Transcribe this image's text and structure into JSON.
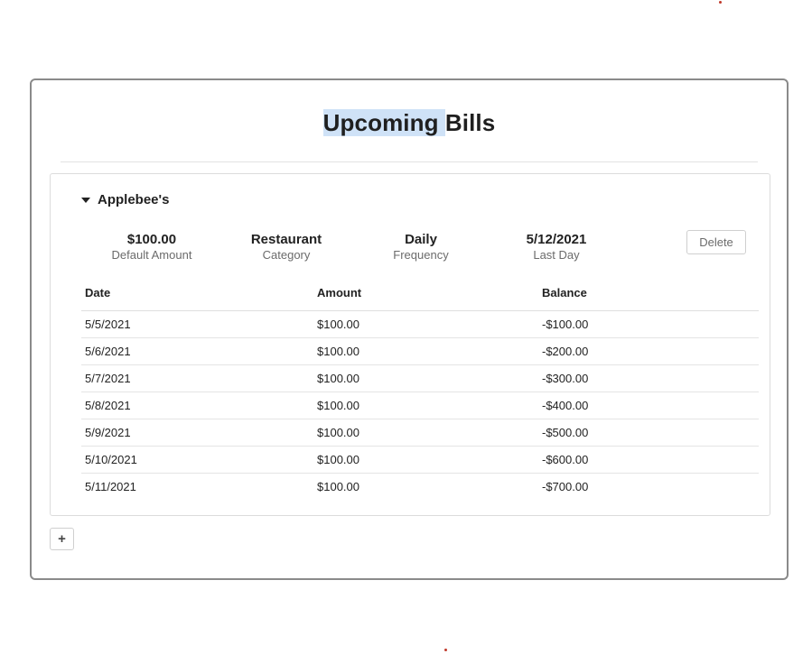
{
  "page": {
    "title_highlighted": "Upcoming ",
    "title_rest": "Bills"
  },
  "bill": {
    "name": "Applebee's",
    "stats": {
      "amount": {
        "value": "$100.00",
        "label": "Default Amount"
      },
      "category": {
        "value": "Restaurant",
        "label": "Category"
      },
      "frequency": {
        "value": "Daily",
        "label": "Frequency"
      },
      "last_day": {
        "value": "5/12/2021",
        "label": "Last Day"
      }
    },
    "delete_label": "Delete",
    "table": {
      "headers": {
        "date": "Date",
        "amount": "Amount",
        "balance": "Balance"
      },
      "rows": [
        {
          "date": "5/5/2021",
          "amount": "$100.00",
          "balance": "-$100.00"
        },
        {
          "date": "5/6/2021",
          "amount": "$100.00",
          "balance": "-$200.00"
        },
        {
          "date": "5/7/2021",
          "amount": "$100.00",
          "balance": "-$300.00"
        },
        {
          "date": "5/8/2021",
          "amount": "$100.00",
          "balance": "-$400.00"
        },
        {
          "date": "5/9/2021",
          "amount": "$100.00",
          "balance": "-$500.00"
        },
        {
          "date": "5/10/2021",
          "amount": "$100.00",
          "balance": "-$600.00"
        },
        {
          "date": "5/11/2021",
          "amount": "$100.00",
          "balance": "-$700.00"
        }
      ]
    }
  },
  "add_label": "+",
  "colors": {
    "title_highlight": "#cfe2f7",
    "panel_border": "#8a8a8a",
    "muted_text": "#6b6b6b"
  }
}
